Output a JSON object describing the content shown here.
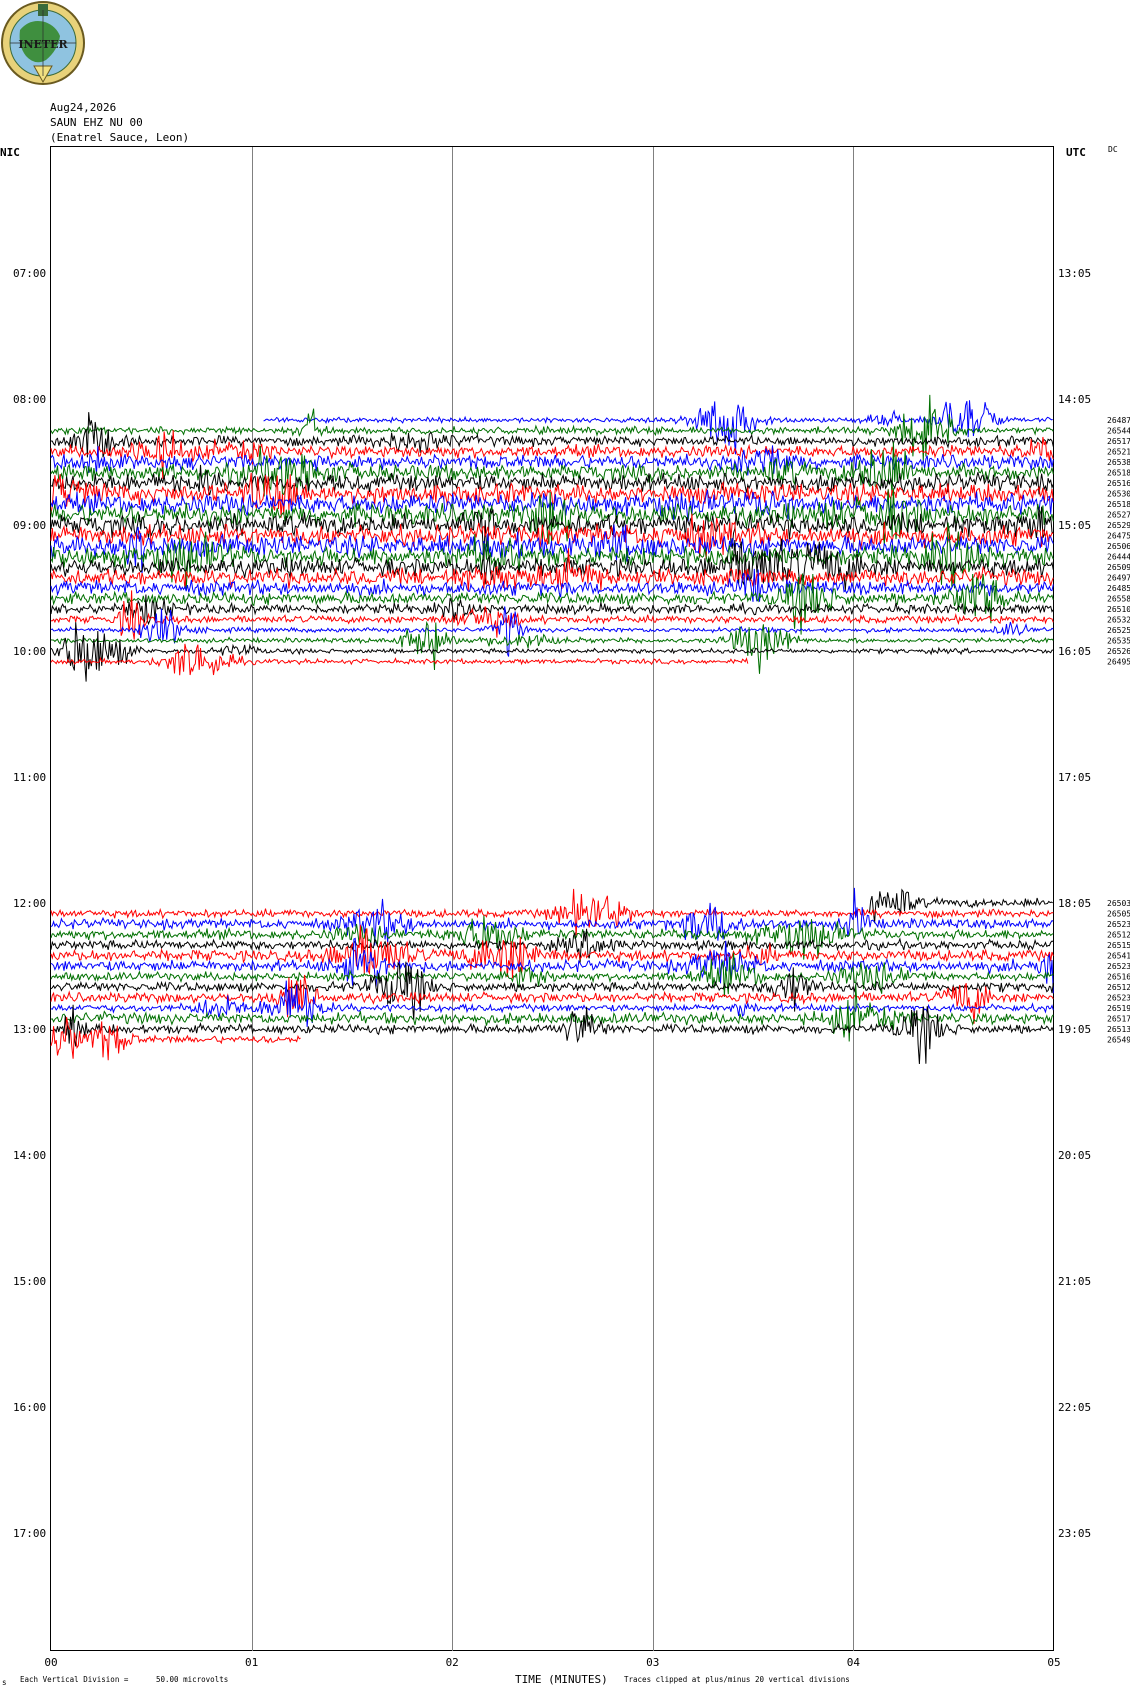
{
  "header": {
    "date": "Aug24,2026",
    "station": "SAUN EHZ NU 00",
    "location": "(Enatrel Sauce, Leon)",
    "left_timezone": "NIC",
    "right_timezone": "UTC",
    "dc_label": "DC",
    "logo_text": "INETER"
  },
  "footer": {
    "vertical_division_label": "Each Vertical Division =",
    "vertical_division_value": "50.00 microvolts",
    "time_axis_label": "TIME (MINUTES)",
    "clip_note": "Traces clipped at plus/minus 20 vertical divisions",
    "corner_mark": "s"
  },
  "colors": {
    "black": "#000000",
    "red": "#ff0000",
    "blue": "#0000ff",
    "green": "#007000",
    "gridline": "#808080"
  },
  "chart_data": {
    "type": "line",
    "title": "SAUN EHZ NU 00",
    "xlabel": "TIME (MINUTES)",
    "xlim": [
      0,
      5
    ],
    "x_tick_labels": [
      "00",
      "01",
      "02",
      "03",
      "04",
      "05"
    ],
    "left_hour_labels": [
      "07:00",
      "08:00",
      "09:00",
      "10:00",
      "11:00",
      "12:00",
      "13:00",
      "14:00",
      "15:00",
      "16:00",
      "17:00"
    ],
    "right_hour_labels": [
      "13:05",
      "14:05",
      "15:05",
      "16:05",
      "17:05",
      "18:05",
      "19:05",
      "20:05",
      "21:05",
      "22:05",
      "23:05"
    ],
    "trace_groups": [
      {
        "name": "morning",
        "start_local": "08:10",
        "labels": [
          "26487",
          "26544",
          "26517",
          "26521",
          "26538",
          "26518",
          "26516",
          "26530",
          "26518",
          "26527",
          "26529",
          "26475",
          "26506",
          "26444",
          "26509",
          "26497",
          "26485",
          "26558",
          "26510",
          "26532",
          "26525",
          "26535",
          "26526",
          "26495"
        ],
        "color_cycle": [
          "blue",
          "green",
          "black",
          "red"
        ],
        "first_trace_start_minute": 1.06,
        "last_trace_end_minute": 3.48
      },
      {
        "name": "afternoon",
        "start_local": "12:00",
        "labels": [
          "26503",
          "26505",
          "26523",
          "26512",
          "26515",
          "26541",
          "26523",
          "26516",
          "26512",
          "26523",
          "26519",
          "26517",
          "26513",
          "26549"
        ],
        "color_cycle": [
          "black",
          "red",
          "blue",
          "green"
        ],
        "first_trace_start_minute": 4.08,
        "last_trace_end_minute": 1.25
      }
    ]
  }
}
